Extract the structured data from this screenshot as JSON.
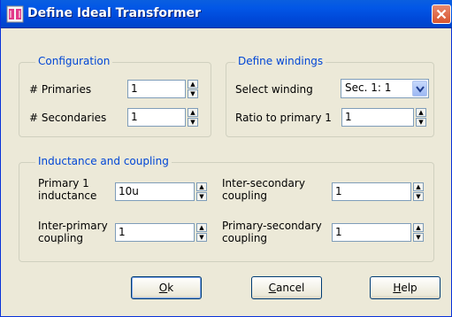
{
  "window": {
    "title": "Define Ideal Transformer",
    "close_icon": "close-icon",
    "app_icon": "transformer-app-icon"
  },
  "configuration": {
    "title": "Configuration",
    "primaries_label": "# Primaries",
    "primaries_value": "1",
    "secondaries_label": "# Secondaries",
    "secondaries_value": "1"
  },
  "windings": {
    "title": "Define windings",
    "select_label": "Select winding",
    "select_value": "Sec. 1: 1",
    "ratio_label": "Ratio to primary 1",
    "ratio_value": "1"
  },
  "inductance": {
    "title": "Inductance and coupling",
    "primary_inductance_label_1": "Primary 1",
    "primary_inductance_label_2": "inductance",
    "primary_inductance_value": "10u",
    "inter_primary_label_1": "Inter-primary",
    "inter_primary_label_2": "coupling",
    "inter_primary_value": "1",
    "inter_secondary_label_1": "Inter-secondary",
    "inter_secondary_label_2": "coupling",
    "inter_secondary_value": "1",
    "primary_secondary_label_1": "Primary-secondary",
    "primary_secondary_label_2": "coupling",
    "primary_secondary_value": "1"
  },
  "buttons": {
    "ok_mnemonic": "O",
    "ok_rest": "k",
    "cancel_mnemonic": "C",
    "cancel_rest": "ancel",
    "help_mnemonic": "H",
    "help_rest": "elp"
  }
}
